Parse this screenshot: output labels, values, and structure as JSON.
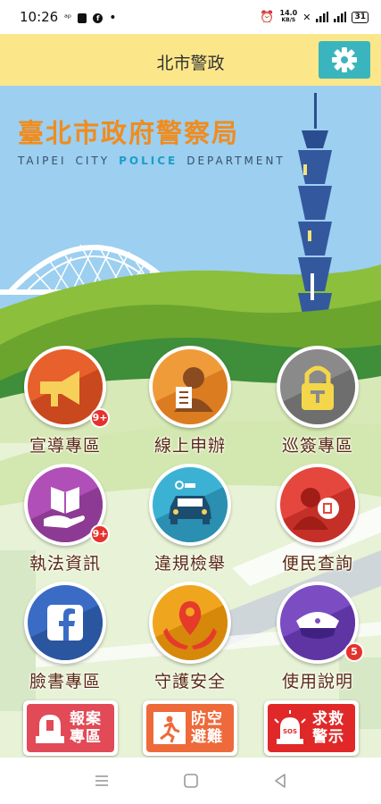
{
  "status_bar": {
    "time": "10:26",
    "left_icons": [
      "vibrate-icon",
      "bag-icon",
      "facebook-icon",
      "dot-icon"
    ],
    "net_speed_value": "14.0",
    "net_speed_unit": "KB/S",
    "battery": "31"
  },
  "app_bar": {
    "title": "北市警政",
    "settings_icon": "gear-icon"
  },
  "hero": {
    "title": "臺北市政府警察局",
    "subtitle": [
      "TAIPEI",
      "CITY",
      "POLICE",
      "DEPARTMENT"
    ]
  },
  "tiles": [
    {
      "label": "宣導專區",
      "icon": "megaphone-icon",
      "badge": "9+",
      "color": "#e8602c"
    },
    {
      "label": "線上申辦",
      "icon": "officer-document-icon",
      "badge": "",
      "color": "#f09b3a"
    },
    {
      "label": "巡簽專區",
      "icon": "padlock-icon",
      "badge": "",
      "color": "#8a8a8a"
    },
    {
      "label": "執法資訊",
      "icon": "book-hand-icon",
      "badge": "9+",
      "color": "#b04fb8"
    },
    {
      "label": "違規檢舉",
      "icon": "car-icon",
      "badge": "",
      "color": "#3bb2d4"
    },
    {
      "label": "便民查詢",
      "icon": "person-search-icon",
      "badge": "",
      "color": "#e5463d"
    },
    {
      "label": "臉書專區",
      "icon": "facebook-icon",
      "badge": "",
      "color": "#3a6cc6"
    },
    {
      "label": "守護安全",
      "icon": "location-hands-icon",
      "badge": "",
      "color": "#f0a51e"
    },
    {
      "label": "使用說明",
      "icon": "police-cap-icon",
      "badge": "5",
      "color": "#7b4cc2"
    }
  ],
  "emergency": [
    {
      "line1": "報案",
      "line2": "專區",
      "icon": "siren-icon",
      "color": "#e14a56"
    },
    {
      "line1": "防空",
      "line2": "避難",
      "icon": "exit-runner-icon",
      "color": "#ee6a3b"
    },
    {
      "line1": "求救",
      "line2": "警示",
      "icon": "sos-icon",
      "color": "#e02828"
    }
  ],
  "nav_bar": [
    "recents-icon",
    "home-icon",
    "back-icon"
  ]
}
